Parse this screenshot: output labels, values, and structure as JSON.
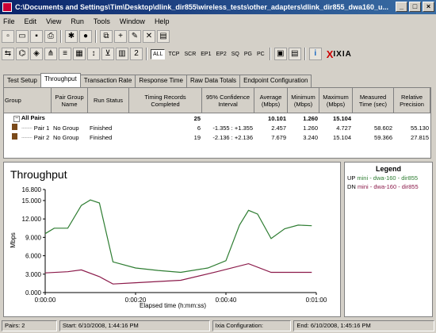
{
  "window": {
    "title": "C:\\Documents and Settings\\Tim\\Desktop\\dlink_dir855\\wireless_tests\\other_adapters\\dlink_dir855_dwa160_u...",
    "min": "_",
    "max": "□",
    "close": "×"
  },
  "menu": [
    "File",
    "Edit",
    "View",
    "Run",
    "Tools",
    "Window",
    "Help"
  ],
  "toolbar2": {
    "tags": [
      "ALL",
      "TCP",
      "SCR",
      "EP1",
      "EP2",
      "SQ",
      "PG",
      "PC"
    ],
    "brand_x": "X",
    "brand_text": "IXIA"
  },
  "tabs": [
    "Test Setup",
    "Throughput",
    "Transaction Rate",
    "Response Time",
    "Raw Data Totals",
    "Endpoint Configuration"
  ],
  "grid": {
    "headers": [
      "Group",
      "Pair Group Name",
      "Run Status",
      "Timing Records Completed",
      "95% Confidence Interval",
      "Average (Mbps)",
      "Minimum (Mbps)",
      "Maximum (Mbps)",
      "Measured Time (sec)",
      "Relative Precision"
    ],
    "all_pairs": {
      "label": "All Pairs",
      "records": "25",
      "avg": "10.101",
      "min": "1.260",
      "max": "15.104"
    },
    "rows": [
      {
        "pair": "Pair 1",
        "group": "No Group",
        "status": "Finished",
        "records": "6",
        "ci": "-1.355 : +1.355",
        "avg": "2.457",
        "min": "1.260",
        "max": "4.727",
        "time": "58.602",
        "precision": "55.130"
      },
      {
        "pair": "Pair 2",
        "group": "No Group",
        "status": "Finished",
        "records": "19",
        "ci": "-2.136 : +2.136",
        "avg": "7.679",
        "min": "3.240",
        "max": "15.104",
        "time": "59.366",
        "precision": "27.815"
      }
    ]
  },
  "chart_data": {
    "type": "line",
    "title": "Throughput",
    "xlabel": "Elapsed time (h:mm:ss)",
    "ylabel": "Mbps",
    "ylim": [
      0,
      16.8
    ],
    "xlim": [
      0,
      60
    ],
    "yticks": [
      "0.000",
      "3.000",
      "6.000",
      "9.000",
      "12.000",
      "15.000",
      "16.800"
    ],
    "xticks": [
      "0:00:00",
      "0:00:20",
      "0:00:40",
      "0:01:00"
    ],
    "grid": false,
    "series": [
      {
        "name": "UP",
        "color": "#2e7d32",
        "x": [
          0,
          2,
          5,
          8,
          10,
          12,
          15,
          20,
          25,
          30,
          36,
          40,
          43,
          45,
          47,
          50,
          53,
          56,
          59
        ],
        "y": [
          9.6,
          10.5,
          10.5,
          14.2,
          15.1,
          14.6,
          5.0,
          4.0,
          3.6,
          3.3,
          4.0,
          5.2,
          11.0,
          13.4,
          12.8,
          8.8,
          10.4,
          11.0,
          10.9
        ]
      },
      {
        "name": "DN",
        "color": "#8b1a4a",
        "x": [
          0,
          5,
          8,
          12,
          15,
          20,
          30,
          38,
          45,
          50,
          55,
          59
        ],
        "y": [
          3.2,
          3.4,
          3.7,
          2.6,
          1.4,
          1.6,
          2.0,
          3.4,
          4.7,
          3.3,
          3.3,
          3.3
        ]
      }
    ]
  },
  "legend": {
    "title": "Legend",
    "items": [
      {
        "tag": "UP",
        "text": "mini - dwa-160 - dir855",
        "color": "#2e7d32"
      },
      {
        "tag": "DN",
        "text": "mini - dwa-160 - dir855",
        "color": "#8b1a4a"
      }
    ]
  },
  "status": {
    "pairs": "Pairs: 2",
    "start": "Start: 6/10/2008, 1:44:16 PM",
    "ixia_config": "Ixia Configuration:",
    "end": "End: 6/10/2008, 1:45:16 PM"
  }
}
